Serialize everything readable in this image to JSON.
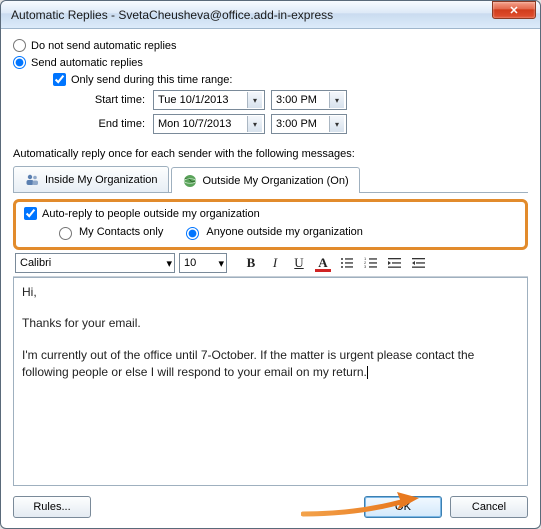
{
  "window": {
    "title": "Automatic Replies - SvetaCheusheva@office.add-in-express"
  },
  "options": {
    "doNotSend": "Do not send automatic replies",
    "send": "Send automatic replies",
    "onlyRange": "Only send during this time range:",
    "startLabel": "Start time:",
    "startDate": "Tue 10/1/2013",
    "startTime": "3:00 PM",
    "endLabel": "End time:",
    "endDate": "Mon 10/7/2013",
    "endTime": "3:00 PM"
  },
  "sectionLabel": "Automatically reply once for each sender with the following messages:",
  "tabs": {
    "inside": "Inside My Organization",
    "outside": "Outside My Organization (On)"
  },
  "outsideBox": {
    "autoReply": "Auto-reply to people outside my organization",
    "contactsOnly": "My Contacts only",
    "anyone": "Anyone outside my organization"
  },
  "toolbar": {
    "fontName": "Calibri",
    "fontSize": "10"
  },
  "message": {
    "p1": "Hi,",
    "p2": "Thanks for your email.",
    "p3": "I'm currently out of the office until 7-October. If the matter is urgent please contact the following people or else I will respond to your email on my return."
  },
  "footer": {
    "rules": "Rules...",
    "ok": "OK",
    "cancel": "Cancel"
  }
}
